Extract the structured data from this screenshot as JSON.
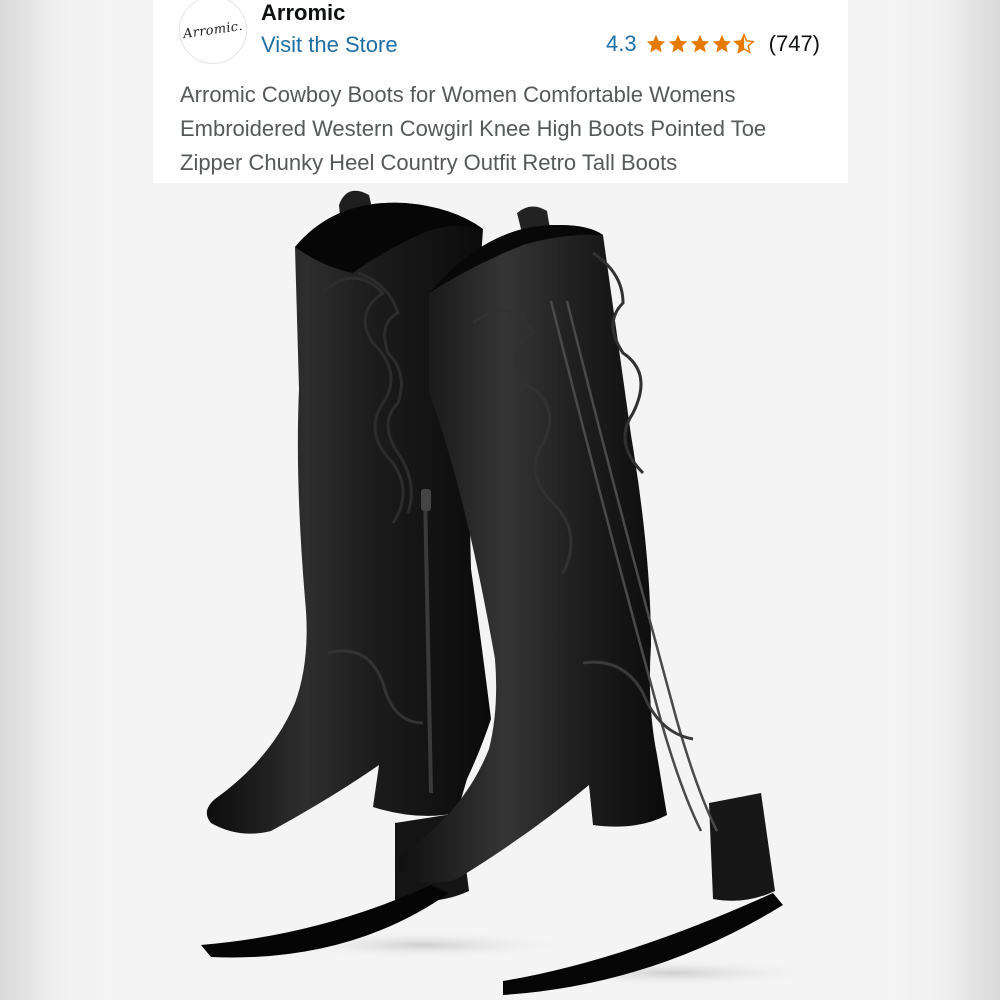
{
  "brand": {
    "logo_text": "Arromic.",
    "name": "Arromic",
    "store_link": "Visit the Store"
  },
  "rating": {
    "value": "4.3",
    "stars": 4.3,
    "count": "(747)",
    "star_color": "#e67a00"
  },
  "product": {
    "title": "Arromic Cowboy Boots for Women Comfortable Womens Embroidered Western Cowgirl Knee High Boots Pointed Toe Zipper Chunky Heel Country Outfit Retro Tall Boots",
    "image_icon": "black-cowboy-boots-image"
  },
  "colors": {
    "link": "#1d6fa5",
    "title_text": "#565959",
    "boot": "#1a1a1a"
  }
}
